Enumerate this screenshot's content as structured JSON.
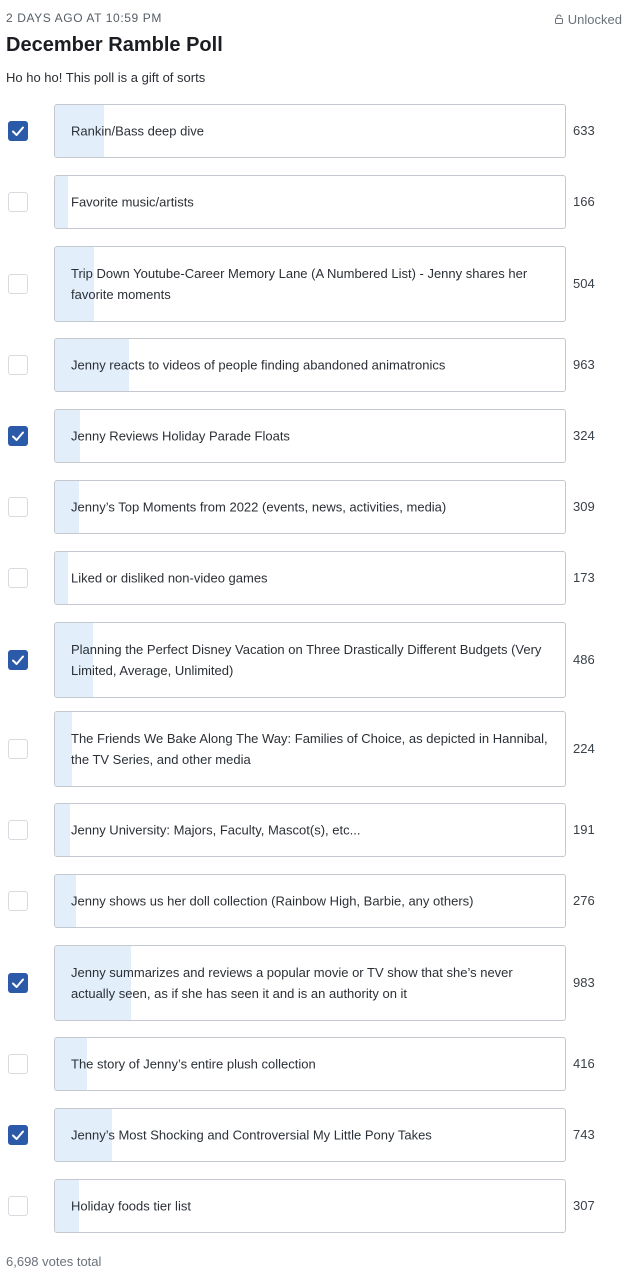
{
  "post": {
    "timestamp": "2 DAYS AGO AT 10:59 PM",
    "lock_label": "Unlocked",
    "title": "December Ramble Poll",
    "subtitle": "Ho ho ho! This poll is a gift of sorts"
  },
  "colors": {
    "checked": "#2a5aa8",
    "bar_fill": "#e3eefb",
    "border": "#c4c9cf"
  },
  "options": [
    {
      "label": "Rankin/Bass deep dive",
      "votes": "633",
      "checked": true
    },
    {
      "label": "Favorite music/artists",
      "votes": "166",
      "checked": false
    },
    {
      "label": "Trip Down Youtube-Career Memory Lane (A Numbered List) - Jenny shares her favorite moments",
      "votes": "504",
      "checked": false
    },
    {
      "label": "Jenny reacts to videos of people finding abandoned animatronics",
      "votes": "963",
      "checked": false
    },
    {
      "label": "Jenny Reviews Holiday Parade Floats",
      "votes": "324",
      "checked": true
    },
    {
      "label": "Jenny’s Top Moments from 2022 (events, news, activities, media)",
      "votes": "309",
      "checked": false
    },
    {
      "label": "Liked or disliked non-video games",
      "votes": "173",
      "checked": false
    },
    {
      "label": "Planning the Perfect Disney Vacation on Three Drastically Different Budgets (Very Limited, Average, Unlimited)",
      "votes": "486",
      "checked": true
    },
    {
      "label": "The Friends We Bake Along The Way: Families of Choice, as depicted in Hannibal, the TV Series, and other media",
      "votes": "224",
      "checked": false
    },
    {
      "label": "Jenny University: Majors, Faculty, Mascot(s), etc...",
      "votes": "191",
      "checked": false
    },
    {
      "label": "Jenny shows us her doll collection (Rainbow High, Barbie, any others)",
      "votes": "276",
      "checked": false
    },
    {
      "label": "Jenny summarizes and reviews a popular movie or TV show that she’s never actually seen, as if she has seen it and is an authority on it",
      "votes": "983",
      "checked": true
    },
    {
      "label": "The story of Jenny’s entire plush collection",
      "votes": "416",
      "checked": false
    },
    {
      "label": "Jenny’s Most Shocking and Controversial My Little Pony Takes",
      "votes": "743",
      "checked": true
    },
    {
      "label": "Holiday foods tier list",
      "votes": "307",
      "checked": false
    }
  ],
  "total_votes_label": "6,698 votes total"
}
